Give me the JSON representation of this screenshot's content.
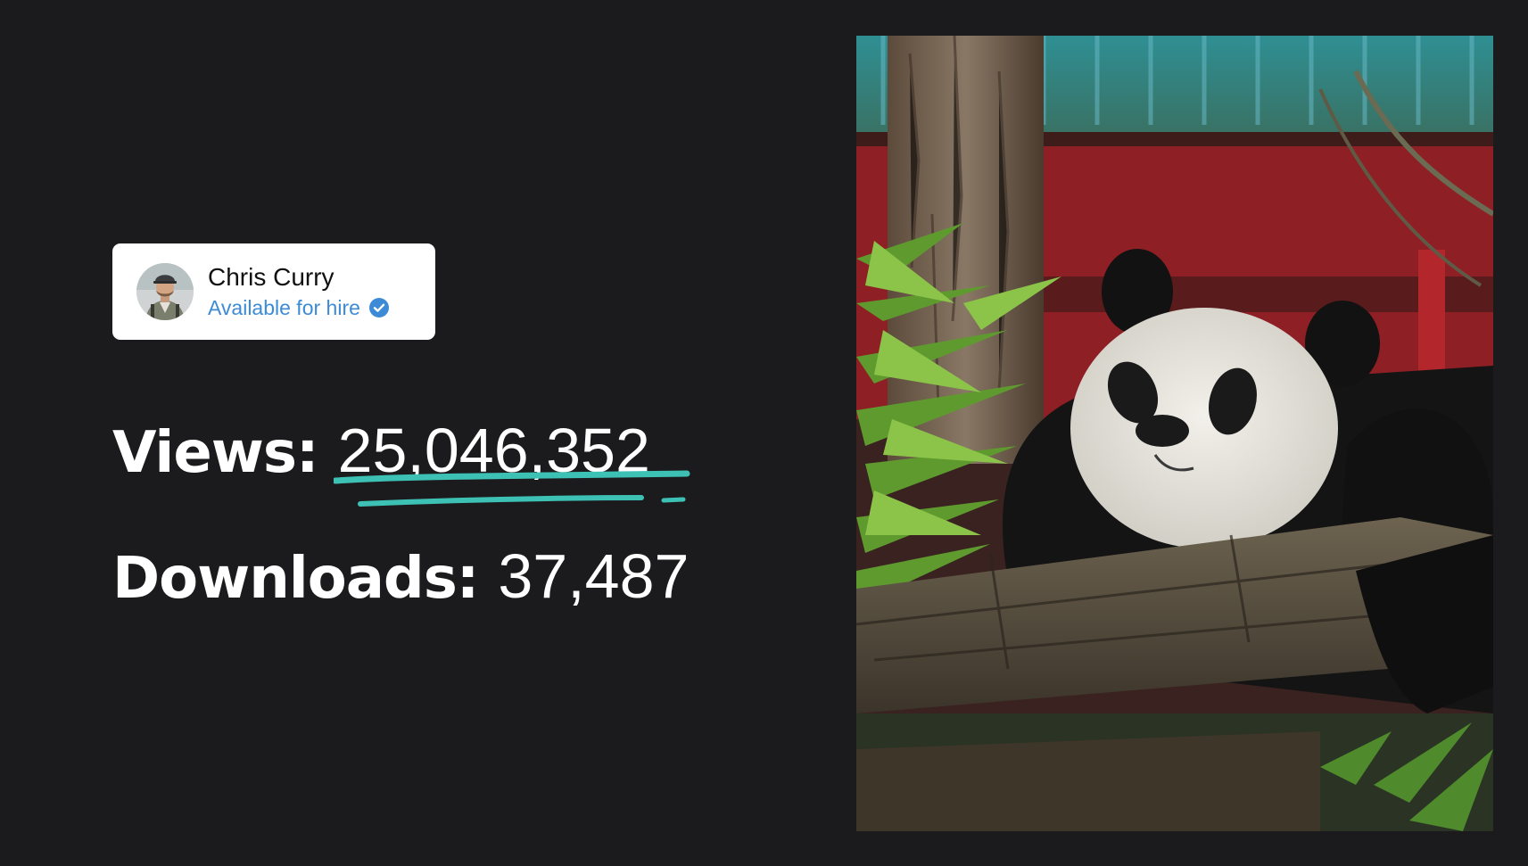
{
  "profile": {
    "name": "Chris Curry",
    "status": "Available for hire",
    "avatar_icon": "person-avatar",
    "verified_icon": "verified-check-icon",
    "status_color": "#3d8bd6"
  },
  "stats": {
    "views_label": "Views:",
    "views_value": "25,046,352",
    "downloads_label": "Downloads:",
    "downloads_value": "37,487"
  },
  "accent_color": "#3ec1b5",
  "background_color": "#1b1b1d",
  "photo": {
    "subject": "giant-panda-photo"
  }
}
